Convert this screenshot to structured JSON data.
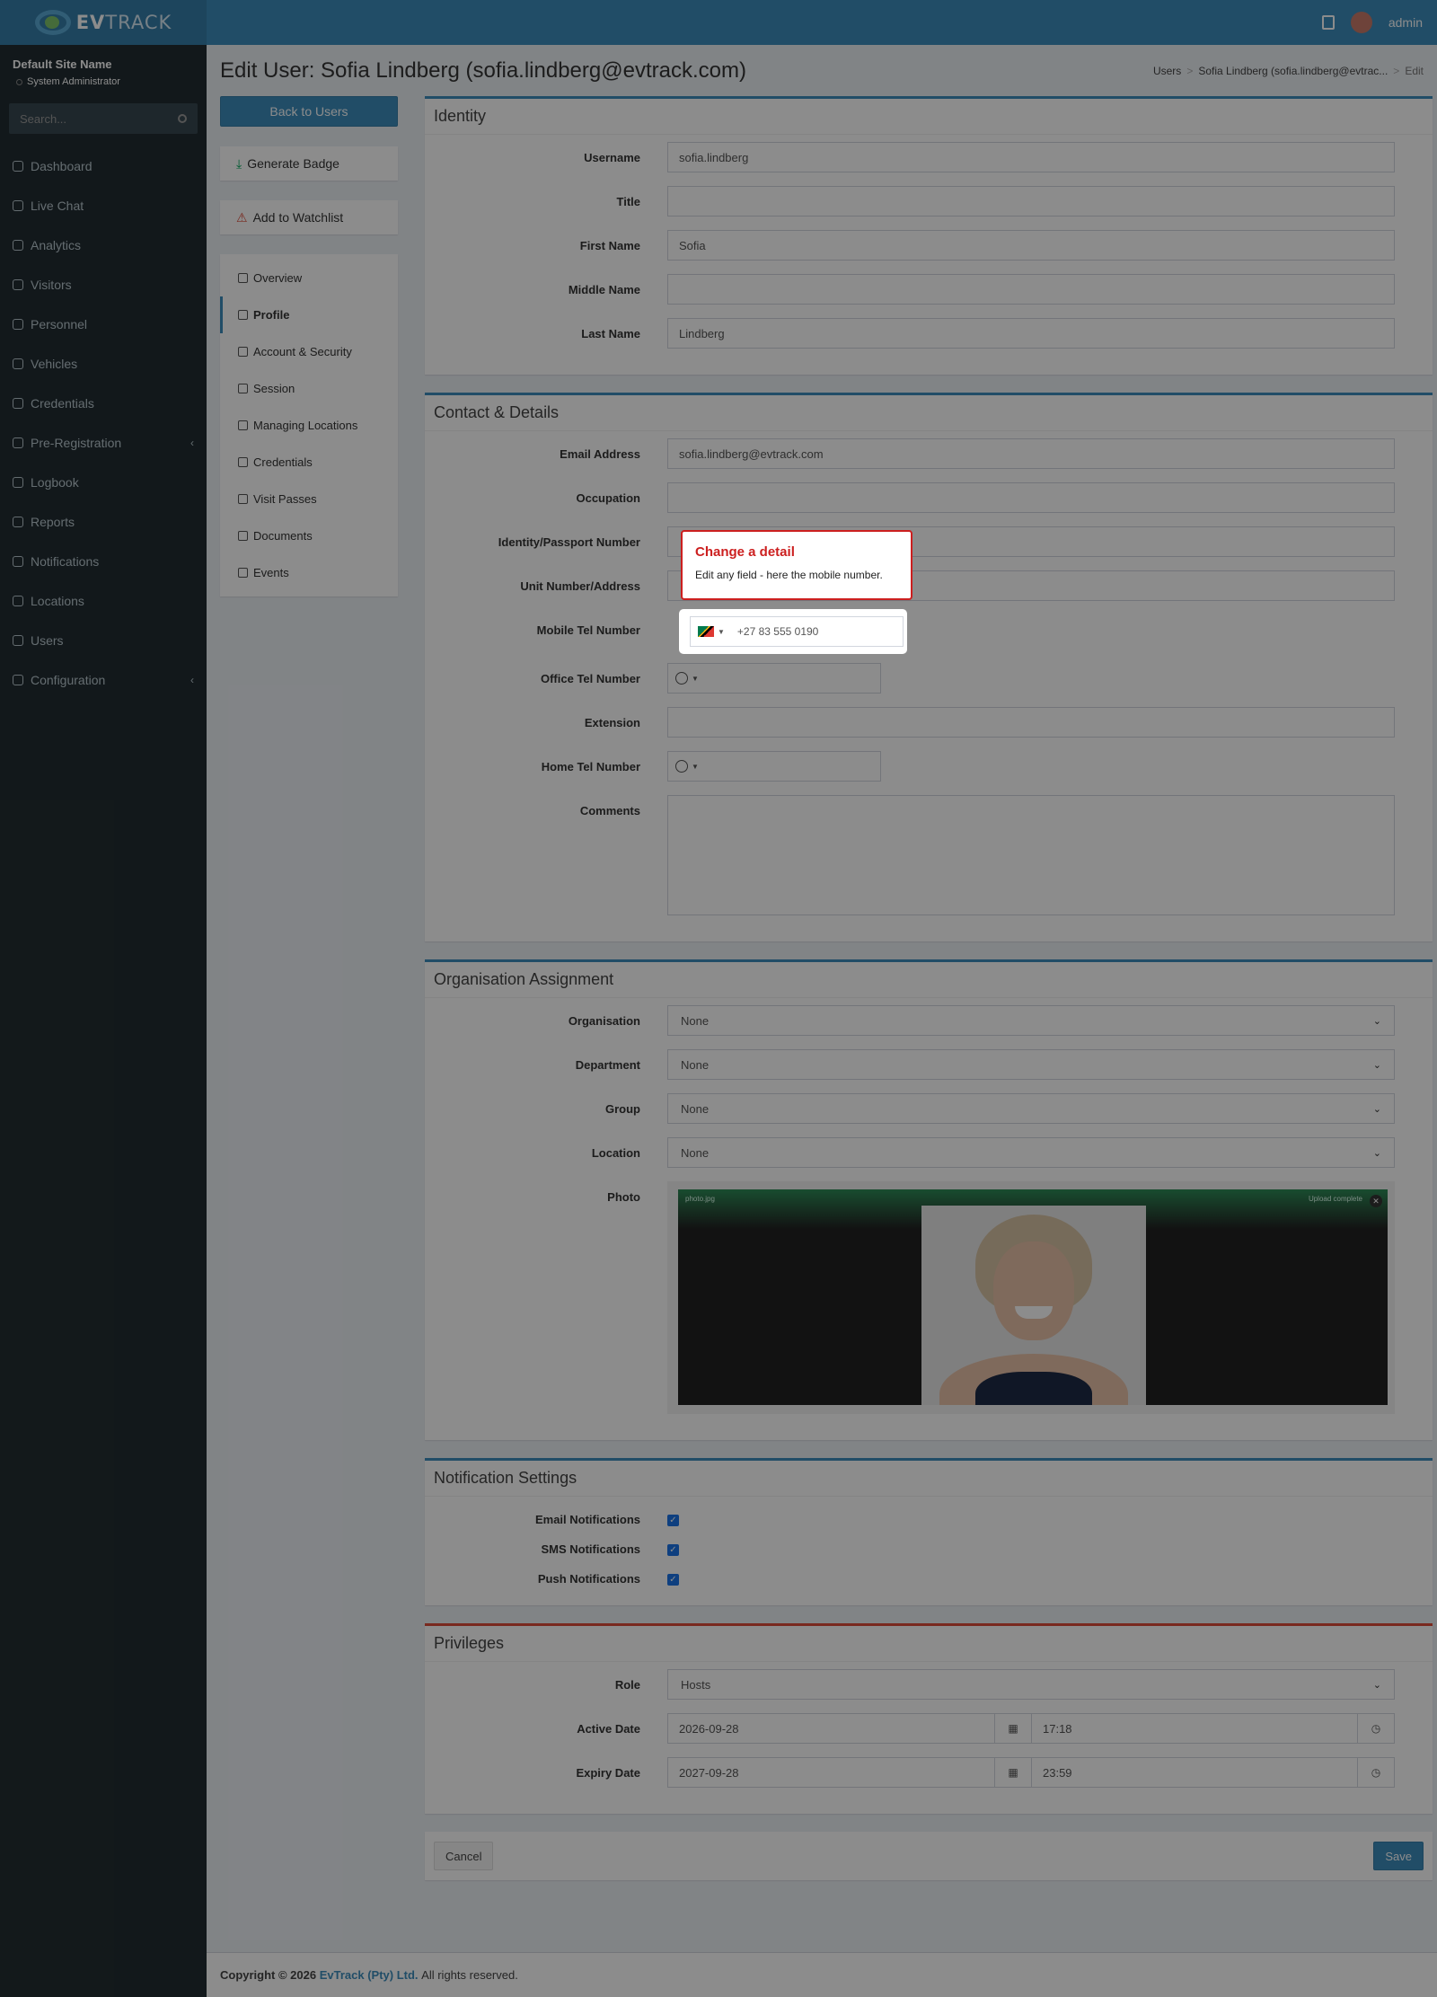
{
  "brand": {
    "name_bold": "EV",
    "name_rest": "TRACK"
  },
  "topbar": {
    "user": "admin"
  },
  "sidebar": {
    "site_name": "Default Site Name",
    "role": "System Administrator",
    "search_placeholder": "Search...",
    "items": [
      {
        "label": "Dashboard",
        "icon": "dashboard-icon"
      },
      {
        "label": "Live Chat",
        "icon": "headset-icon"
      },
      {
        "label": "Analytics",
        "icon": "analytics-icon"
      },
      {
        "label": "Visitors",
        "icon": "eye-icon"
      },
      {
        "label": "Personnel",
        "icon": "personnel-icon"
      },
      {
        "label": "Vehicles",
        "icon": "car-icon"
      },
      {
        "label": "Credentials",
        "icon": "credentials-icon"
      },
      {
        "label": "Pre-Registration",
        "icon": "exchange-icon",
        "caret": "‹"
      },
      {
        "label": "Logbook",
        "icon": "book-icon"
      },
      {
        "label": "Reports",
        "icon": "reports-icon"
      },
      {
        "label": "Notifications",
        "icon": "notifications-icon"
      },
      {
        "label": "Locations",
        "icon": "building-icon"
      },
      {
        "label": "Users",
        "icon": "users-icon"
      },
      {
        "label": "Configuration",
        "icon": "gear-icon",
        "caret": "‹"
      }
    ]
  },
  "header": {
    "title": "Edit User: Sofia Lindberg (sofia.lindberg@evtrack.com)",
    "breadcrumb": [
      "Users",
      "Sofia Lindberg (sofia.lindberg@evtrac...",
      "Edit"
    ]
  },
  "left_menu": {
    "back_label": "Back to Users",
    "generate_badge": "Generate Badge",
    "watchlist": "Add to Watchlist",
    "items": [
      "Overview",
      "Profile",
      "Account & Security",
      "Session",
      "Managing Locations",
      "Credentials",
      "Visit Passes",
      "Documents",
      "Events"
    ]
  },
  "identity": {
    "title": "Identity",
    "fields": [
      {
        "label": "Username",
        "value": "sofia.lindberg"
      },
      {
        "label": "Title",
        "value": ""
      },
      {
        "label": "First Name",
        "value": "Sofia"
      },
      {
        "label": "Middle Name",
        "value": ""
      },
      {
        "label": "Last Name",
        "value": "Lindberg"
      }
    ]
  },
  "contact": {
    "title": "Contact & Details",
    "email_label": "Email Address",
    "email": "sofia.lindberg@evtrack.com",
    "occupation_label": "Occupation",
    "occupation": "",
    "idnum_label": "Identity/Passport Number",
    "idnum": "",
    "unit_label": "Unit Number/Address",
    "unit": "",
    "mobile_label": "Mobile Tel Number",
    "mobile": "+27 83 555 0190",
    "office_label": "Office Tel Number",
    "office": "",
    "ext_label": "Extension",
    "ext": "",
    "home_label": "Home Tel Number",
    "home": "",
    "comments_label": "Comments"
  },
  "org": {
    "title": "Organisation Assignment",
    "fields": [
      {
        "label": "Organisation",
        "value": "None"
      },
      {
        "label": "Department",
        "value": "None"
      },
      {
        "label": "Group",
        "value": "None"
      },
      {
        "label": "Location",
        "value": "None"
      }
    ],
    "photo_label": "Photo",
    "photo_file": "photo.jpg",
    "photo_status": "Upload complete"
  },
  "notif": {
    "title": "Notification Settings",
    "items": [
      "Email Notifications",
      "SMS Notifications",
      "Push Notifications"
    ]
  },
  "priv": {
    "title": "Privileges",
    "role_label": "Role",
    "role": "Hosts",
    "active_label": "Active Date",
    "active_date": "2026-09-28",
    "active_time": "17:18",
    "expiry_label": "Expiry Date",
    "expiry_date": "2027-09-28",
    "expiry_time": "23:59"
  },
  "actions": {
    "cancel": "Cancel",
    "save": "Save"
  },
  "footer": {
    "copyright": "Copyright © 2026",
    "company": "EvTrack (Pty) Ltd.",
    "rights": "All rights reserved."
  },
  "tour": {
    "title": "Change a detail",
    "body": "Edit any field - here the mobile number."
  }
}
